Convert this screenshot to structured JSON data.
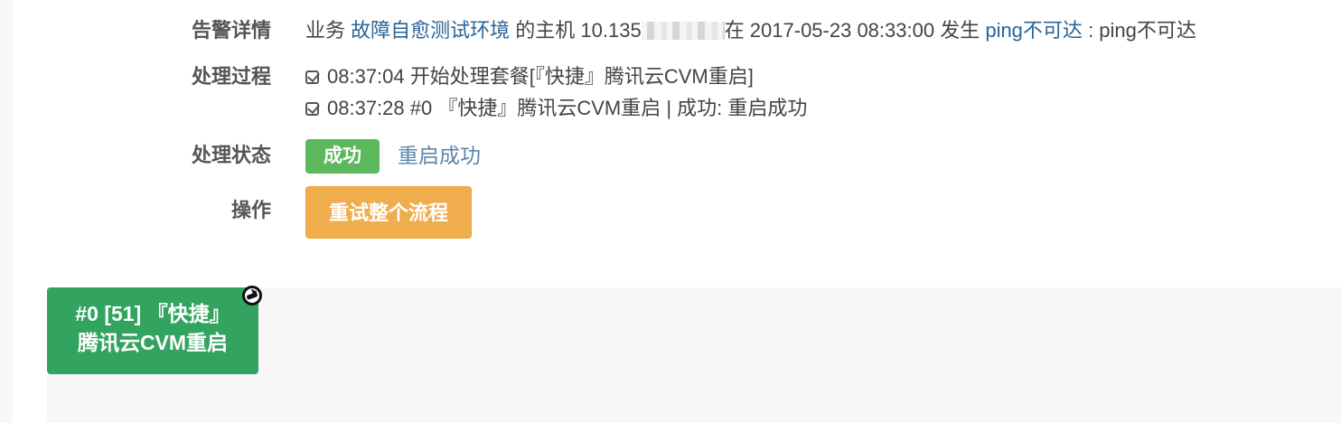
{
  "details": {
    "alert": {
      "label": "告警详情",
      "prefix": "业务",
      "business_link": "故障自愈测试环境",
      "host_text": "的主机 10.135",
      "time_text": "在 2017-05-23 08:33:00 发生",
      "alarm_link": "ping不可达",
      "suffix": ": ping不可达"
    },
    "process": {
      "label": "处理过程",
      "steps": [
        {
          "text": "08:37:04 开始处理套餐[『快捷』腾讯云CVM重启]"
        },
        {
          "text": "08:37:28 #0 『快捷』腾讯云CVM重启 | 成功: 重启成功"
        }
      ]
    },
    "status": {
      "label": "处理状态",
      "badge": "成功",
      "text": "重启成功",
      "badge_color": "#5cb85c"
    },
    "action": {
      "label": "操作",
      "button": "重试整个流程",
      "button_color": "#f0ad4e"
    }
  },
  "flow": {
    "node": {
      "line1": "#0 [51] 『快捷』",
      "line2": "腾讯云CVM重启",
      "color": "#33a45f",
      "icon": "refresh-icon"
    }
  }
}
